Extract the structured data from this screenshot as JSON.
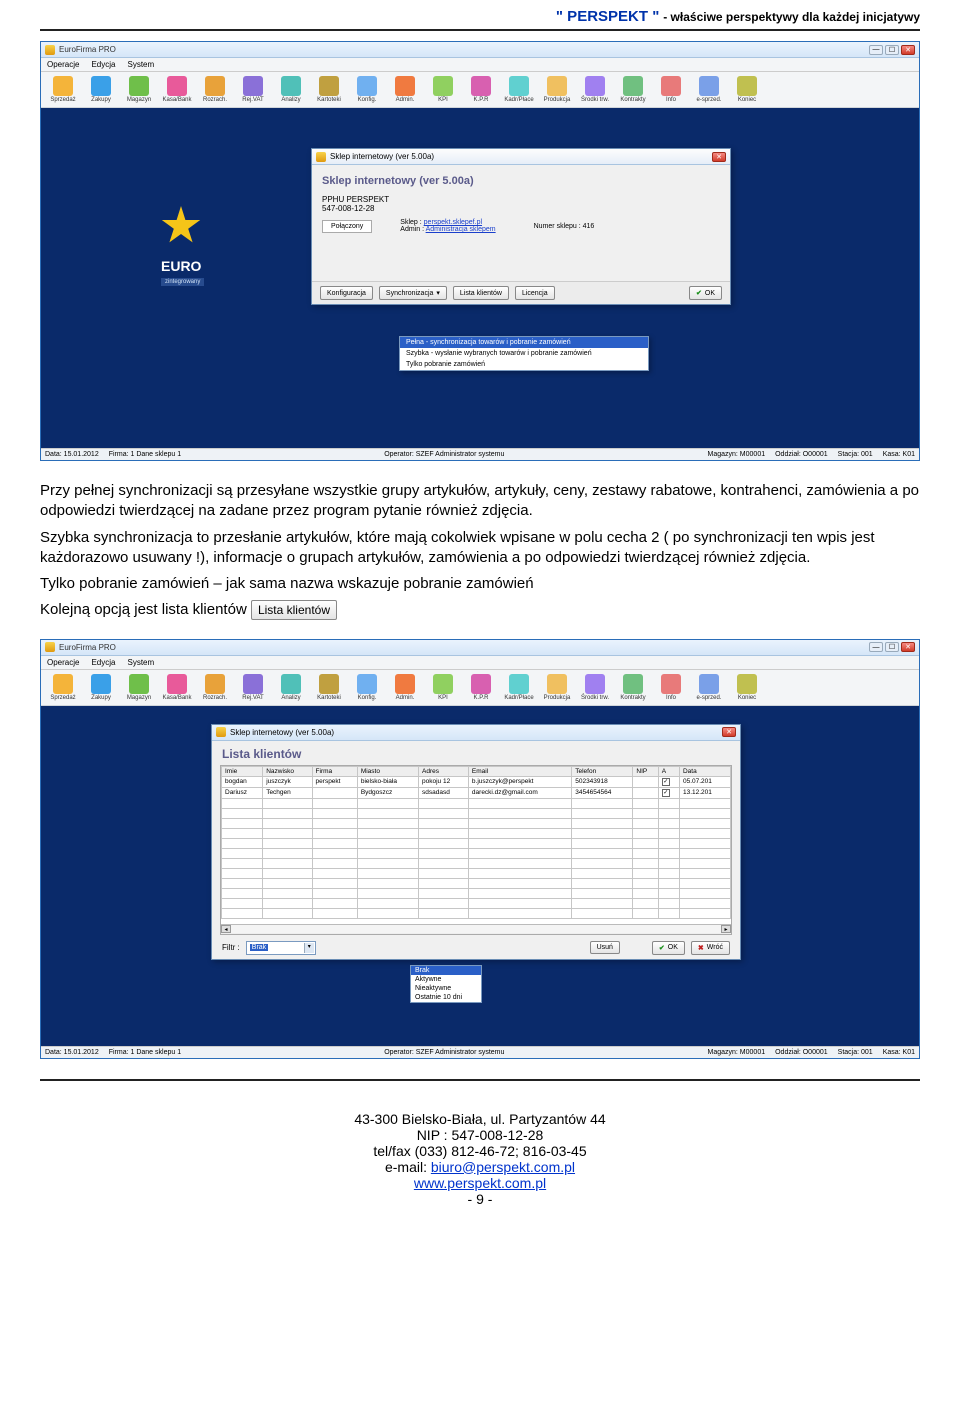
{
  "header": {
    "brand": "\" PERSPEKT \"",
    "tagline": "- właściwe perspektywy dla każdej inicjatywy"
  },
  "app": {
    "title": "EuroFirma PRO",
    "menus": [
      "Operacje",
      "Edycja",
      "System"
    ],
    "toolbar": [
      {
        "label": "Sprzedaż"
      },
      {
        "label": "Zakupy"
      },
      {
        "label": "Magazyn"
      },
      {
        "label": "Kasa/Bank"
      },
      {
        "label": "Rozrach."
      },
      {
        "label": "Rej.VAT"
      },
      {
        "label": "Analizy"
      },
      {
        "label": "Kartoteki"
      },
      {
        "label": "Konfig."
      },
      {
        "label": "Admin."
      },
      {
        "label": "KPI"
      },
      {
        "label": "K.P.R"
      },
      {
        "label": "Kadr/Płace"
      },
      {
        "label": "Produkcja"
      },
      {
        "label": "Środki trw."
      },
      {
        "label": "Kontrakty"
      },
      {
        "label": "Info"
      },
      {
        "label": "e-sprzed."
      },
      {
        "label": "Koniec"
      }
    ],
    "logo_text": "EURO",
    "logo_sub": "zintegrowany"
  },
  "dialog1": {
    "titlebar": "Sklep internetowy (ver 5.00a)",
    "heading": "Sklep internetowy (ver 5.00a)",
    "company": "PPHU PERSPEKT",
    "nip": "547-008-12-28",
    "conn_label": "Połączony",
    "sklep_label": "Sklep :",
    "sklep_value": "perspekt.sklepef.pl",
    "admin_label": "Admin :",
    "admin_value": "Administracja sklepem",
    "numer_label": "Numer sklepu : 416",
    "buttons": {
      "konfig": "Konfiguracja",
      "synch": "Synchronizacja",
      "lista": "Lista klientów",
      "licencja": "Licencja",
      "ok": "OK"
    },
    "dropdown": [
      "Pełna - synchronizacja towarów i pobranie zamówień",
      "Szybka - wysłanie wybranych towarów i pobranie zamówień",
      "Tylko pobranie zamówień"
    ]
  },
  "statusbar": {
    "data": "Data: 15.01.2012",
    "firma": "Firma: 1 Dane sklepu 1",
    "operator": "Operator: SZEF Administrator systemu",
    "magazyn": "Magazyn: M00001",
    "oddzial": "Oddział: O00001",
    "stacja": "Stacja: 001",
    "kasa": "Kasa: K01"
  },
  "body_text": {
    "p1": "Przy pełnej synchronizacji są przesyłane wszystkie grupy artykułów, artykuły, ceny, zestawy rabatowe, kontrahenci, zamówienia a po odpowiedzi twierdzącej na zadane przez program pytanie również zdjęcia.",
    "p2": "Szybka synchronizacja to przesłanie artykułów, które mają cokolwiek wpisane w polu cecha 2 ( po synchronizacji ten wpis jest każdorazowo usuwany !), informacje o grupach artykułów, zamówienia a po odpowiedzi twierdzącej również zdjęcia.",
    "p3": "Tylko pobranie zamówień – jak sama nazwa wskazuje pobranie zamówień",
    "p4_pre": "Kolejną opcją jest lista klientów ",
    "inline_btn": "Lista klientów"
  },
  "dialog2": {
    "titlebar": "Sklep internetowy (ver 5.00a)",
    "heading": "Lista klientów",
    "columns": [
      "Imie",
      "Nazwisko",
      "Firma",
      "Miasto",
      "Adres",
      "Email",
      "Telefon",
      "NIP",
      "A",
      "Data"
    ],
    "rows": [
      {
        "imie": "bogdan",
        "nazwisko": "juszczyk",
        "firma": "perspekt",
        "miasto": "bielsko-biała",
        "adres": "pokoju 12",
        "email": "b.juszczyk@perspekt",
        "telefon": "502343918",
        "nip": "",
        "a": "✓",
        "data": "05.07.201"
      },
      {
        "imie": "Dariusz",
        "nazwisko": "Techgen",
        "firma": "",
        "miasto": "Bydgoszcz",
        "adres": "sdsadasd",
        "email": "darecki.dz@gmail.com",
        "telefon": "3454654564",
        "nip": "",
        "a": "✓",
        "data": "13.12.201"
      }
    ],
    "filter_label": "Filtr :",
    "filter_selected": "Brak",
    "filter_options": [
      "Brak",
      "Aktywne",
      "Nieaktywne",
      "Ostatnie 10 dni"
    ],
    "btn_usun": "Usuń",
    "btn_ok": "OK",
    "btn_wroc": "Wróć"
  },
  "footer": {
    "l1": "43-300 Bielsko-Biała, ul. Partyzantów 44",
    "l2": "NIP : 547-008-12-28",
    "l3": "tel/fax (033) 812-46-72; 816-03-45",
    "l4_pre": "e-mail: ",
    "l4_link": "biuro@perspekt.com.pl",
    "l5_link": "www.perspekt.com.pl",
    "page": "- 9 -"
  }
}
